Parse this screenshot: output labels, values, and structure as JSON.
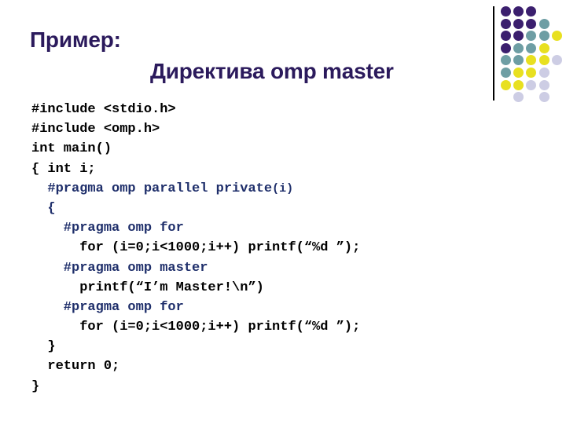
{
  "slide": {
    "background_color": "#ffffff",
    "title": {
      "line1": "Пример:",
      "line2": "Директива omp master",
      "color": "#2B1A5C"
    },
    "code": {
      "text_color": "#000000",
      "pragma_color": "#1F2F6B",
      "lines": [
        {
          "text": "#include <stdio.h>",
          "style": "plain"
        },
        {
          "text": "#include <omp.h>",
          "style": "plain"
        },
        {
          "text": "int main()",
          "style": "plain"
        },
        {
          "text": "{ int i;",
          "style": "plain"
        },
        {
          "text": "  #pragma omp parallel private",
          "style": "pragma",
          "small_suffix": "(i)"
        },
        {
          "text": "  {",
          "style": "pragma"
        },
        {
          "text": "    #pragma omp for",
          "style": "pragma"
        },
        {
          "text": "      for (i=0;i<1000;i++) printf(“%d ”);",
          "style": "plain"
        },
        {
          "text": "    #pragma omp master",
          "style": "pragma"
        },
        {
          "text": "      printf(“I’m Master!\\n”)",
          "style": "plain"
        },
        {
          "text": "    #pragma omp for",
          "style": "pragma"
        },
        {
          "text": "      for (i=0;i<1000;i++) printf(“%d ”);",
          "style": "plain"
        },
        {
          "text": "  }",
          "style": "plain"
        },
        {
          "text": "  return 0;",
          "style": "plain"
        },
        {
          "text": "}",
          "style": "plain"
        }
      ]
    },
    "decoration": {
      "divider_color": "#000000",
      "colors": {
        "purple": "#3B1F6E",
        "teal": "#6E9EA4",
        "yellow": "#E8E020",
        "lavender": "#CDCDE4"
      },
      "dots": [
        {
          "row": 0,
          "col": 0,
          "color": "#3B1F6E"
        },
        {
          "row": 0,
          "col": 1,
          "color": "#3B1F6E"
        },
        {
          "row": 0,
          "col": 2,
          "color": "#3B1F6E"
        },
        {
          "row": 1,
          "col": 0,
          "color": "#3B1F6E"
        },
        {
          "row": 1,
          "col": 1,
          "color": "#3B1F6E"
        },
        {
          "row": 1,
          "col": 2,
          "color": "#3B1F6E"
        },
        {
          "row": 1,
          "col": 3,
          "color": "#6E9EA4"
        },
        {
          "row": 2,
          "col": 0,
          "color": "#3B1F6E"
        },
        {
          "row": 2,
          "col": 1,
          "color": "#3B1F6E"
        },
        {
          "row": 2,
          "col": 2,
          "color": "#6E9EA4"
        },
        {
          "row": 2,
          "col": 3,
          "color": "#6E9EA4"
        },
        {
          "row": 2,
          "col": 4,
          "color": "#E8E020"
        },
        {
          "row": 3,
          "col": 0,
          "color": "#3B1F6E"
        },
        {
          "row": 3,
          "col": 1,
          "color": "#6E9EA4"
        },
        {
          "row": 3,
          "col": 2,
          "color": "#6E9EA4"
        },
        {
          "row": 3,
          "col": 3,
          "color": "#E8E020"
        },
        {
          "row": 4,
          "col": 0,
          "color": "#6E9EA4"
        },
        {
          "row": 4,
          "col": 1,
          "color": "#6E9EA4"
        },
        {
          "row": 4,
          "col": 2,
          "color": "#E8E020"
        },
        {
          "row": 4,
          "col": 3,
          "color": "#E8E020"
        },
        {
          "row": 4,
          "col": 4,
          "color": "#CDCDE4"
        },
        {
          "row": 5,
          "col": 0,
          "color": "#6E9EA4"
        },
        {
          "row": 5,
          "col": 1,
          "color": "#E8E020"
        },
        {
          "row": 5,
          "col": 2,
          "color": "#E8E020"
        },
        {
          "row": 5,
          "col": 3,
          "color": "#CDCDE4"
        },
        {
          "row": 6,
          "col": 0,
          "color": "#E8E020"
        },
        {
          "row": 6,
          "col": 1,
          "color": "#E8E020"
        },
        {
          "row": 6,
          "col": 2,
          "color": "#CDCDE4"
        },
        {
          "row": 6,
          "col": 3,
          "color": "#CDCDE4"
        },
        {
          "row": 7,
          "col": 1,
          "color": "#CDCDE4"
        },
        {
          "row": 7,
          "col": 3,
          "color": "#CDCDE4"
        }
      ]
    }
  }
}
